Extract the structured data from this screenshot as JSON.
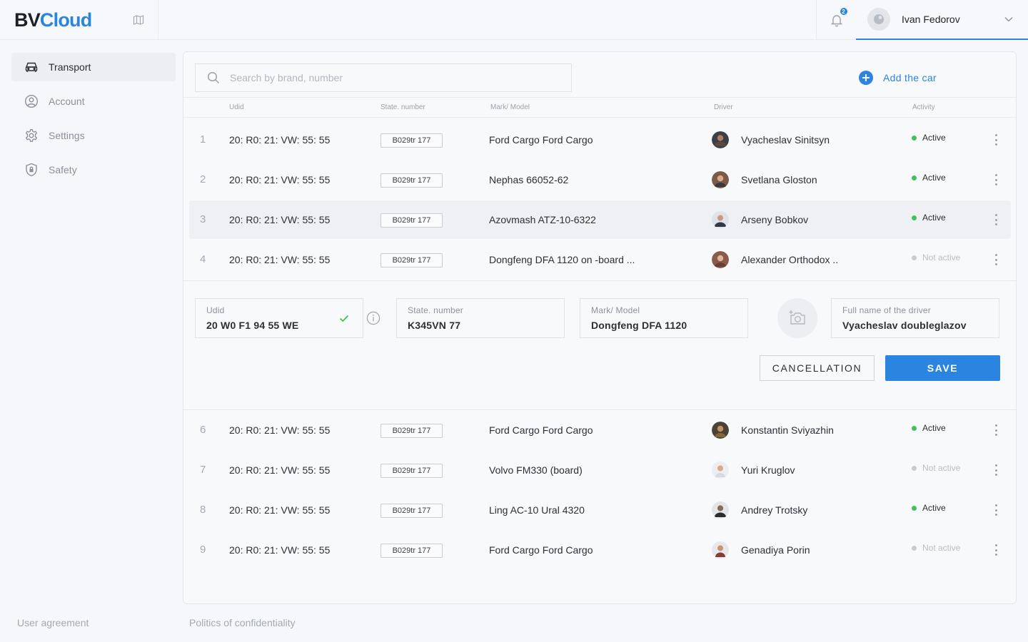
{
  "brand": {
    "part1": "BV",
    "part2": "Cloud"
  },
  "colors": {
    "accent": "#2a84e0",
    "active": "#3fc25b",
    "inactive": "#c7cbd3"
  },
  "header": {
    "notification_count": "2",
    "user_name": "Ivan Fedorov"
  },
  "sidebar": {
    "items": [
      {
        "label": "Transport",
        "icon": "car-icon",
        "active": true
      },
      {
        "label": "Account",
        "icon": "user-circle-icon",
        "active": false
      },
      {
        "label": "Settings",
        "icon": "gear-icon",
        "active": false
      },
      {
        "label": "Safety",
        "icon": "shield-icon",
        "active": false
      }
    ]
  },
  "footer": {
    "user_agreement": "User agreement",
    "privacy": "Politics of confidentiality"
  },
  "toolbar": {
    "search_placeholder": "Search by brand, number",
    "add_car": "Add the car"
  },
  "table": {
    "columns": {
      "udid": "Udid",
      "state_number": "State. number",
      "model": "Mark/ Model",
      "driver": "Driver",
      "activity": "Activity"
    },
    "rows": [
      {
        "num": "1",
        "udid": "20: R0: 21: VW: 55: 55",
        "plate": "B029tr 177",
        "model": "Ford Cargo Ford Cargo",
        "driver": "Vyacheslav Sinitsyn",
        "status": "Active",
        "active": true
      },
      {
        "num": "2",
        "udid": "20: R0: 21: VW: 55: 55",
        "plate": "B029tr 177",
        "model": "Nephas 66052-62",
        "driver": "Svetlana Gloston",
        "status": "Active",
        "active": true
      },
      {
        "num": "3",
        "udid": "20: R0: 21: VW: 55: 55",
        "plate": "B029tr 177",
        "model": "Azovmash ATZ-10-6322",
        "driver": "Arseny Bobkov",
        "status": "Active",
        "active": true
      },
      {
        "num": "4",
        "udid": "20: R0: 21: VW: 55: 55",
        "plate": "B029tr 177",
        "model": "Dongfeng DFA 1120 on -board ...",
        "driver": "Alexander Orthodox ..",
        "status": "Not active",
        "active": false
      },
      {
        "num": "6",
        "udid": "20: R0: 21: VW: 55: 55",
        "plate": "B029tr 177",
        "model": "Ford Cargo Ford Cargo",
        "driver": "Konstantin Sviyazhin",
        "status": "Active",
        "active": true
      },
      {
        "num": "7",
        "udid": "20: R0: 21: VW: 55: 55",
        "plate": "B029tr 177",
        "model": "Volvo FM330 (board)",
        "driver": "Yuri Kruglov",
        "status": "Not active",
        "active": false
      },
      {
        "num": "8",
        "udid": "20: R0: 21: VW: 55: 55",
        "plate": "B029tr 177",
        "model": "Ling AC-10 Ural 4320",
        "driver": "Andrey Trotsky",
        "status": "Active",
        "active": true
      },
      {
        "num": "9",
        "udid": "20: R0: 21: VW: 55: 55",
        "plate": "B029tr 177",
        "model": "Ford Cargo Ford Cargo",
        "driver": "Genadiya Porin",
        "status": "Not active",
        "active": false
      }
    ]
  },
  "edit_form": {
    "udid_label": "Udid",
    "udid_value": "20 W0 F1 94 55 WE",
    "state_label": "State. number",
    "state_value": "K345VN 77",
    "model_label": "Mark/ Model",
    "model_value": "Dongfeng DFA 1120",
    "driver_label": "Full name of the driver",
    "driver_value": "Vyacheslav doubleglazov",
    "cancel": "CANCELLATION",
    "save": "SAVE"
  }
}
